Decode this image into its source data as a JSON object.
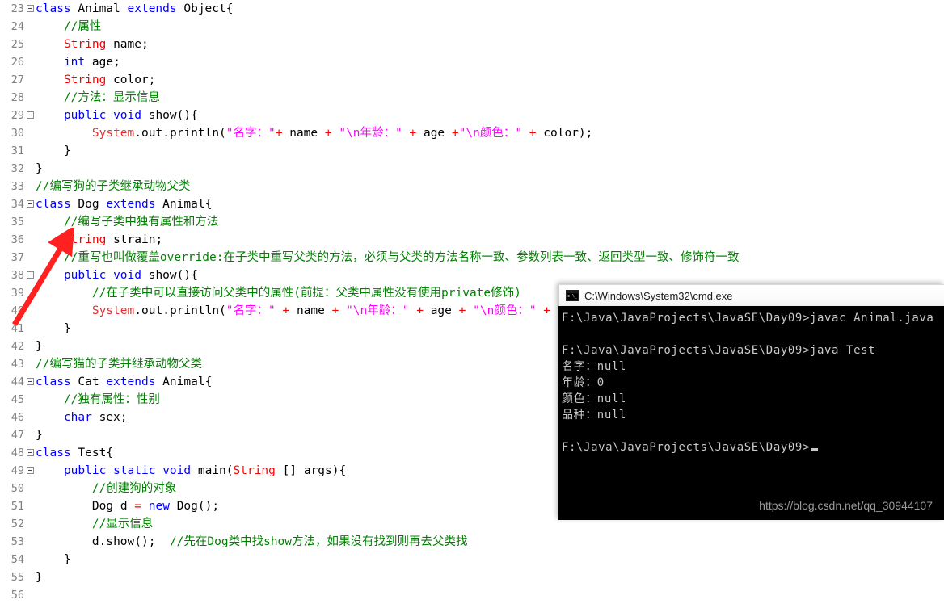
{
  "editor": {
    "first_line_number": 23,
    "gutter_color": "#808080",
    "background": "#ffffff",
    "syntax_colors": {
      "keyword": "#0000ff",
      "type": "#ff0000",
      "string": "#ff00ff",
      "comment": "#008000",
      "operator": "#ff0000",
      "plain": "#000000"
    },
    "lines": [
      {
        "n": "23",
        "fold": true,
        "text": "class Animal extends Object{"
      },
      {
        "n": "24",
        "fold": false,
        "text": "    //属性"
      },
      {
        "n": "25",
        "fold": false,
        "text": "    String name;"
      },
      {
        "n": "26",
        "fold": false,
        "text": "    int age;"
      },
      {
        "n": "27",
        "fold": false,
        "text": "    String color;"
      },
      {
        "n": "28",
        "fold": false,
        "text": "    //方法：显示信息"
      },
      {
        "n": "29",
        "fold": true,
        "text": "    public void show(){"
      },
      {
        "n": "30",
        "fold": false,
        "text": "        System.out.println(\"名字：\"+ name + \"\\n年龄：\" + age +\"\\n颜色：\" + color);"
      },
      {
        "n": "31",
        "fold": false,
        "text": "    }"
      },
      {
        "n": "32",
        "fold": false,
        "text": "}"
      },
      {
        "n": "33",
        "fold": false,
        "text": "//编写狗的子类继承动物父类"
      },
      {
        "n": "34",
        "fold": true,
        "text": "class Dog extends Animal{"
      },
      {
        "n": "35",
        "fold": false,
        "text": "    //编写子类中独有属性和方法"
      },
      {
        "n": "36",
        "fold": false,
        "text": "    String strain;"
      },
      {
        "n": "37",
        "fold": false,
        "text": "    //重写也叫做覆盖override:在子类中重写父类的方法，必须与父类的方法名称一致、参数列表一致、返回类型一致、修饰符一致"
      },
      {
        "n": "38",
        "fold": true,
        "text": "    public void show(){"
      },
      {
        "n": "39",
        "fold": false,
        "text": "        //在子类中可以直接访问父类中的属性(前提：父类中属性没有使用private修饰)"
      },
      {
        "n": "40",
        "fold": false,
        "text": "        System.out.println(\"名字：\" + name + \"\\n年龄：\" + age + \"\\n颜色：\" + color + \"\\n品种：\" + strain);"
      },
      {
        "n": "41",
        "fold": false,
        "text": "    }"
      },
      {
        "n": "42",
        "fold": false,
        "text": "}"
      },
      {
        "n": "43",
        "fold": false,
        "text": "//编写猫的子类并继承动物父类"
      },
      {
        "n": "44",
        "fold": true,
        "text": "class Cat extends Animal{"
      },
      {
        "n": "45",
        "fold": false,
        "text": "    //独有属性：性别"
      },
      {
        "n": "46",
        "fold": false,
        "text": "    char sex;"
      },
      {
        "n": "47",
        "fold": false,
        "text": "}"
      },
      {
        "n": "48",
        "fold": true,
        "text": "class Test{"
      },
      {
        "n": "49",
        "fold": true,
        "text": "    public static void main(String [] args){"
      },
      {
        "n": "50",
        "fold": false,
        "text": "        //创建狗的对象"
      },
      {
        "n": "51",
        "fold": false,
        "text": "        Dog d = new Dog();"
      },
      {
        "n": "52",
        "fold": false,
        "text": "        //显示信息"
      },
      {
        "n": "53",
        "fold": false,
        "text": "        d.show();  //先在Dog类中找show方法，如果没有找到则再去父类找"
      },
      {
        "n": "54",
        "fold": false,
        "text": "    }"
      },
      {
        "n": "55",
        "fold": false,
        "text": "}"
      },
      {
        "n": "56",
        "fold": false,
        "text": ""
      }
    ]
  },
  "annotation": {
    "arrow_color": "#ff2020",
    "points_to": "public void show() on line 38"
  },
  "cmd_window": {
    "title": "C:\\Windows\\System32\\cmd.exe",
    "icon": "console-icon",
    "background": "#000000",
    "text_color": "#c8c8c8",
    "lines": [
      "F:\\Java\\JavaProjects\\JavaSE\\Day09>javac Animal.java",
      "",
      "F:\\Java\\JavaProjects\\JavaSE\\Day09>java Test",
      "名字：null",
      "年龄：0",
      "颜色：null",
      "品种：null",
      "",
      "F:\\Java\\JavaProjects\\JavaSE\\Day09>"
    ],
    "prompt_cursor": true
  },
  "watermark": {
    "text": "https://blog.csdn.net/qq_30944107"
  }
}
